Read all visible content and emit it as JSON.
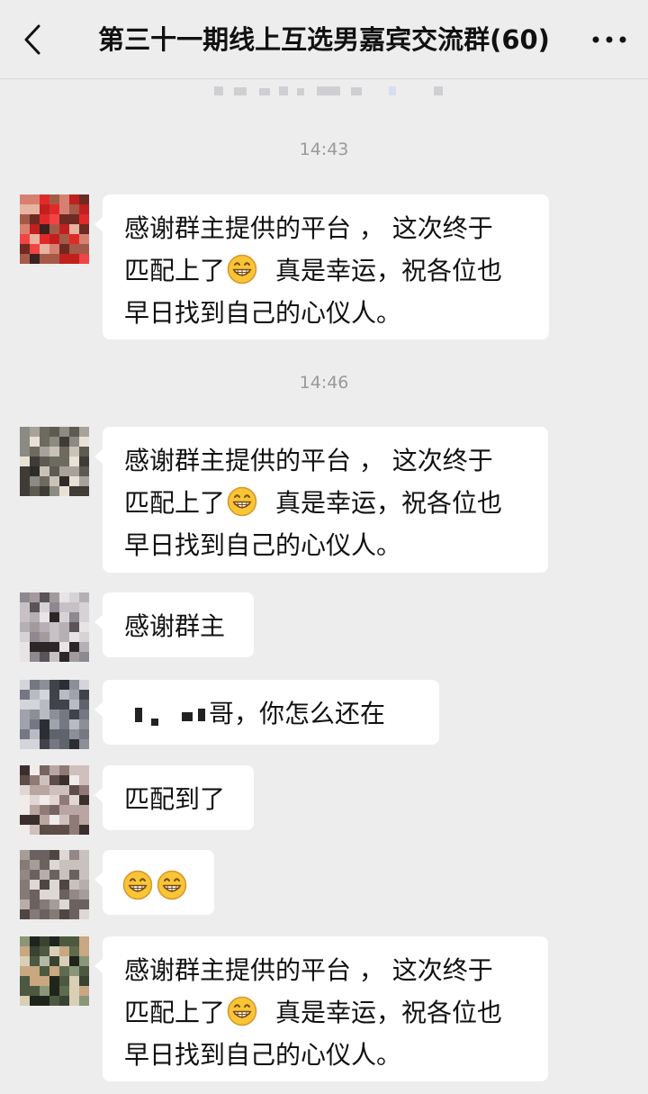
{
  "header": {
    "title": "第三十一期线上互选男嘉宾交流群(60)"
  },
  "timestamps": [
    "14:43",
    "14:46"
  ],
  "messages": [
    {
      "lines": [
        "感谢群主提供的平台 ， 这次终于",
        "匹配上了",
        "真是幸运，祝各位也",
        "早日找到自己的心仪人。"
      ],
      "emoji": "grinning-face"
    },
    {
      "lines": [
        "感谢群主提供的平台 ， 这次终于",
        "匹配上了",
        "真是幸运，祝各位也",
        "早日找到自己的心仪人。"
      ],
      "emoji": "grinning-face"
    },
    {
      "text": "感谢群主"
    },
    {
      "text_after_redaction": "哥，你怎么还在"
    },
    {
      "text": "匹配到了"
    },
    {
      "emojis": [
        "grinning-face",
        "grinning-face"
      ]
    },
    {
      "lines": [
        "感谢群主提供的平台 ， 这次终于",
        "匹配上了",
        "真是幸运，祝各位也",
        "早日找到自己的心仪人。"
      ],
      "emoji": "grinning-face"
    }
  ],
  "colors": {
    "background": "#ededed",
    "bubble": "#ffffff",
    "timestamp": "#9a9a9a"
  }
}
